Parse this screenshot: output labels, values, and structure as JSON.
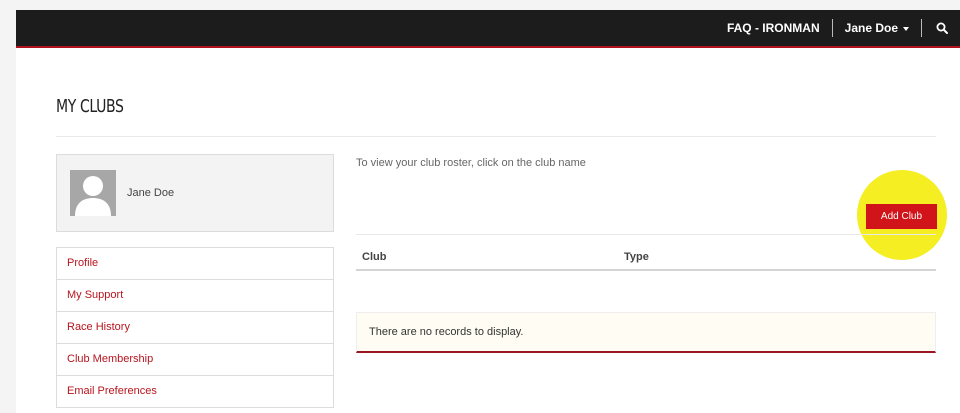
{
  "topbar": {
    "faq_label": "FAQ - IRONMAN",
    "user_label": "Jane Doe",
    "search_icon": "search-icon"
  },
  "page": {
    "title": "MY CLUBS"
  },
  "profile": {
    "name": "Jane Doe",
    "avatar_icon": "user-silhouette-icon"
  },
  "sidebar": {
    "items": [
      {
        "label": "Profile"
      },
      {
        "label": "My Support"
      },
      {
        "label": "Race History"
      },
      {
        "label": "Club Membership"
      },
      {
        "label": "Email Preferences"
      }
    ]
  },
  "main": {
    "intro": "To view your club roster, click on the club name",
    "add_club_label": "Add Club",
    "table": {
      "columns": [
        "Club",
        "Type"
      ],
      "empty_message": "There are no records to display."
    }
  },
  "colors": {
    "accent_red": "#d0141a",
    "link_red": "#b8141e",
    "highlight_yellow": "#f4ee22",
    "topbar": "#1c1c1c"
  }
}
